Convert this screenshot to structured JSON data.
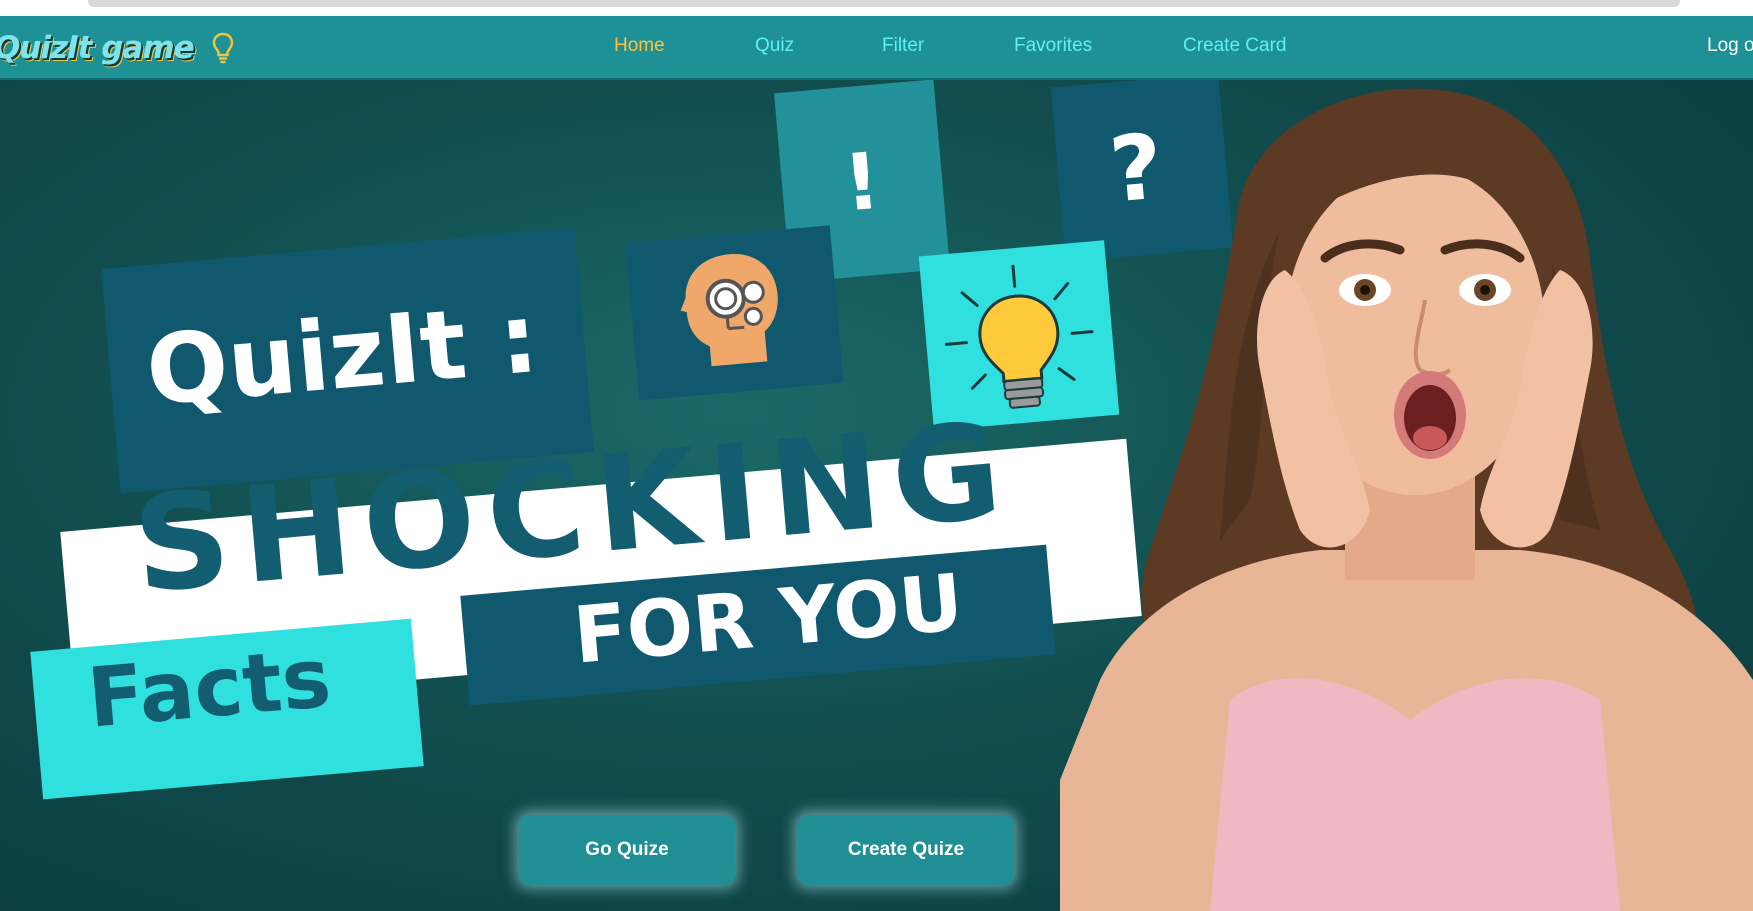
{
  "brand": {
    "name": "QuizIt game"
  },
  "nav": {
    "links": [
      {
        "label": "Home",
        "active": true
      },
      {
        "label": "Quiz",
        "active": false
      },
      {
        "label": "Filter",
        "active": false
      },
      {
        "label": "Favorites",
        "active": false
      },
      {
        "label": "Create Card",
        "active": false
      }
    ],
    "login_label": "Log out"
  },
  "hero": {
    "headline_quizit": "QuizIt :",
    "headline_shocking": "SHOCKING",
    "headline_for_you": "FOR YOU",
    "headline_facts": "Facts",
    "tile_exclamation": "!",
    "tile_question": "?",
    "go_quiz_label": "Go Quize",
    "create_quiz_label": "Create Quize"
  },
  "colors": {
    "navbar": "#1e9196",
    "nav_active": "#ffc43a",
    "nav_link": "#5ff0f5",
    "hero_bg": "#124e4f",
    "tile_dark": "#10586e",
    "tile_cyan": "#30e0df",
    "button": "#1f8f95"
  },
  "icons": [
    "lightbulb-icon",
    "head-gears-icon",
    "lightbulb-rays-icon"
  ]
}
